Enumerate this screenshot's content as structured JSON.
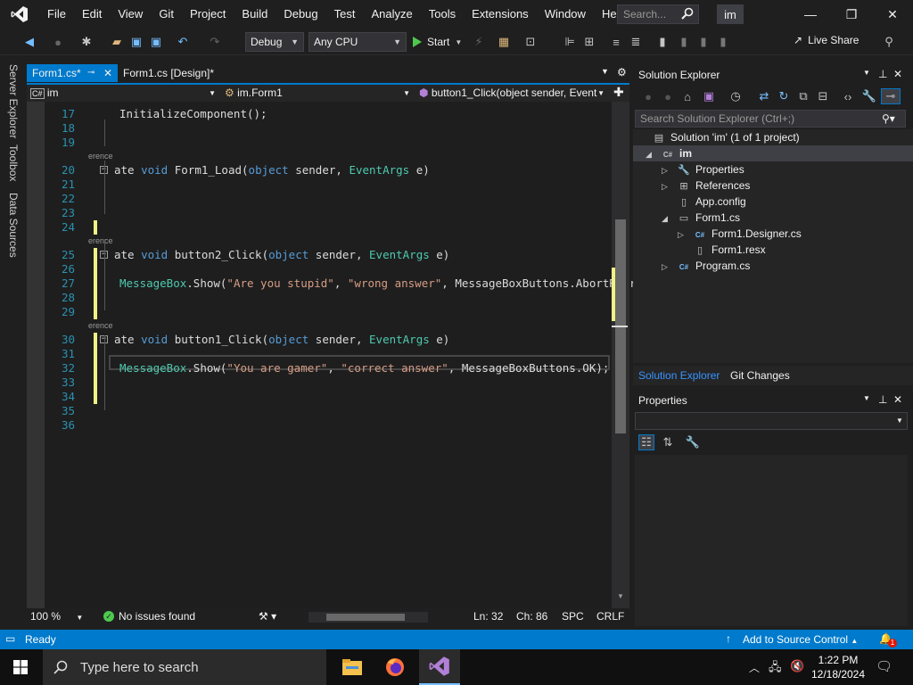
{
  "menu": {
    "items": [
      "File",
      "Edit",
      "View",
      "Git",
      "Project",
      "Build",
      "Debug",
      "Test",
      "Analyze",
      "Tools",
      "Extensions",
      "Window",
      "Help"
    ],
    "search_placeholder": "Search...",
    "solution_badge": "im"
  },
  "toolbar": {
    "config": "Debug",
    "platform": "Any CPU",
    "start_label": "Start",
    "live_share": "Live Share"
  },
  "left_strip": [
    "Server Explorer",
    "Toolbox",
    "Data Sources"
  ],
  "tabs": [
    {
      "label": "Form1.cs*",
      "active": true
    },
    {
      "label": "Form1.cs [Design]*",
      "active": false
    }
  ],
  "navbar": {
    "project": "im",
    "class": "im.Form1",
    "member": "button1_Click(object sender, Event"
  },
  "code": {
    "ref_label": "erence",
    "lines": [
      {
        "n": "17",
        "t": [
          [
            "InitializeComponent();",
            ""
          ]
        ]
      },
      {
        "n": "18",
        "t": []
      },
      {
        "n": "19",
        "t": []
      },
      {
        "n": "20",
        "t": [
          [
            "ate ",
            ""
          ],
          [
            "void ",
            "kw"
          ],
          [
            "Form1_Load(",
            ""
          ],
          [
            "object ",
            "kw"
          ],
          [
            "sender, ",
            ""
          ],
          [
            "EventArgs ",
            "ty"
          ],
          [
            "e)",
            ""
          ]
        ]
      },
      {
        "n": "21",
        "t": []
      },
      {
        "n": "22",
        "t": []
      },
      {
        "n": "23",
        "t": []
      },
      {
        "n": "24",
        "t": []
      },
      {
        "n": "25",
        "t": [
          [
            "ate ",
            ""
          ],
          [
            "void ",
            "kw"
          ],
          [
            "button2_Click(",
            ""
          ],
          [
            "object ",
            "kw"
          ],
          [
            "sender, ",
            ""
          ],
          [
            "EventArgs ",
            "ty"
          ],
          [
            "e)",
            ""
          ]
        ]
      },
      {
        "n": "26",
        "t": []
      },
      {
        "n": "27",
        "t": [
          [
            "MessageBox",
            "ty"
          ],
          [
            ".Show(",
            ""
          ],
          [
            "\"Are you stupid\"",
            "str"
          ],
          [
            ", ",
            ""
          ],
          [
            "\"wrong answer\"",
            "str"
          ],
          [
            ", MessageBoxButtons.AbortRetryIg",
            ""
          ]
        ]
      },
      {
        "n": "28",
        "t": []
      },
      {
        "n": "29",
        "t": []
      },
      {
        "n": "30",
        "t": [
          [
            "ate ",
            ""
          ],
          [
            "void ",
            "kw"
          ],
          [
            "button1_Click(",
            ""
          ],
          [
            "object ",
            "kw"
          ],
          [
            "sender, ",
            ""
          ],
          [
            "EventArgs ",
            "ty"
          ],
          [
            "e)",
            ""
          ]
        ]
      },
      {
        "n": "31",
        "t": []
      },
      {
        "n": "32",
        "t": [
          [
            "MessageBox",
            "ty"
          ],
          [
            ".Show(",
            ""
          ],
          [
            "\"You are gamer\"",
            "str"
          ],
          [
            ", ",
            ""
          ],
          [
            "\"correct answer\"",
            "str"
          ],
          [
            ", MessageBoxButtons.OK);",
            ""
          ]
        ]
      },
      {
        "n": "33",
        "t": []
      },
      {
        "n": "34",
        "t": []
      },
      {
        "n": "35",
        "t": []
      },
      {
        "n": "36",
        "t": []
      }
    ]
  },
  "editor_status": {
    "zoom": "100 %",
    "issues": "No issues found",
    "line": "Ln: 32",
    "col": "Ch: 86",
    "spacing": "SPC",
    "eol": "CRLF"
  },
  "solution_explorer": {
    "title": "Solution Explorer",
    "search_placeholder": "Search Solution Explorer (Ctrl+;)",
    "tree": [
      {
        "label": "Solution 'im' (1 of 1 project)",
        "icon": "solution-icon",
        "toggle": ""
      },
      {
        "label": "im",
        "icon": "csharp-project-icon",
        "toggle": "◢"
      },
      {
        "label": "Properties",
        "icon": "wrench-icon",
        "toggle": "▷"
      },
      {
        "label": "References",
        "icon": "references-icon",
        "toggle": "▷"
      },
      {
        "label": "App.config",
        "icon": "config-file-icon",
        "toggle": ""
      },
      {
        "label": "Form1.cs",
        "icon": "form-icon",
        "toggle": "◢"
      },
      {
        "label": "Form1.Designer.cs",
        "icon": "csharp-file-icon",
        "toggle": "▷"
      },
      {
        "label": "Form1.resx",
        "icon": "resx-file-icon",
        "toggle": ""
      },
      {
        "label": "Program.cs",
        "icon": "csharp-file-icon",
        "toggle": "▷"
      }
    ],
    "bottom_tabs": [
      "Solution Explorer",
      "Git Changes"
    ]
  },
  "properties": {
    "title": "Properties"
  },
  "statusbar": {
    "ready": "Ready",
    "source_control": "Add to Source Control",
    "notifications": "1"
  },
  "taskbar": {
    "search_placeholder": "Type here to search",
    "time": "1:22 PM",
    "date": "12/18/2024"
  },
  "colors": {
    "accent": "#007acc",
    "keyword": "#569cd6",
    "type": "#4ec9b0",
    "string": "#d69d85",
    "line_number": "#2b91af",
    "change_marker": "#eff284"
  }
}
